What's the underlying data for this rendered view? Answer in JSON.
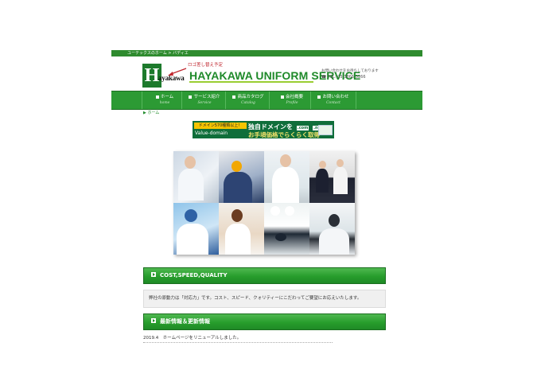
{
  "topbar": {
    "text": "ユーテックスのホーム > バディエ"
  },
  "header": {
    "logo_letter": "H",
    "logo_text": "ayakawa",
    "note": "ロゴ差し替え予定",
    "site_title": "HAYAKAWA UNIFORM SERVICE",
    "contact_note": "お問い合わせをお待ちしております",
    "tel": "TEL: 03-3866-3266"
  },
  "nav": {
    "items": [
      {
        "label": "ホーム",
        "sub": "home"
      },
      {
        "label": "サービス紹介",
        "sub": "Service"
      },
      {
        "label": "商品カタログ",
        "sub": "Catalog"
      },
      {
        "label": "会社概要",
        "sub": "Profile"
      },
      {
        "label": "お問い合わせ",
        "sub": "Contact"
      }
    ]
  },
  "breadcrumb": "ホーム",
  "ad": {
    "badge": "ドメイン570種類以上！",
    "brand": "Value-domain",
    "main": "独自ドメインを",
    "tags": [
      ".com",
      ".net"
    ],
    "sub": "お手頃価格でらくらく取得"
  },
  "sections": {
    "cost": {
      "title": "COST,SPEED,QUALITY",
      "body": "弊社の原動力は「対応力」です。コスト、スピード、クォリティーにこだわってご要望にお応えいたします。"
    },
    "news": {
      "title": "最新情報＆更新情報",
      "items": [
        "2019.4　ホームページをリニューアルしました。"
      ]
    }
  },
  "colors": {
    "brand_green": "#2c9a34",
    "title_green": "#1f8a2a",
    "accent_red": "#c0262e"
  }
}
